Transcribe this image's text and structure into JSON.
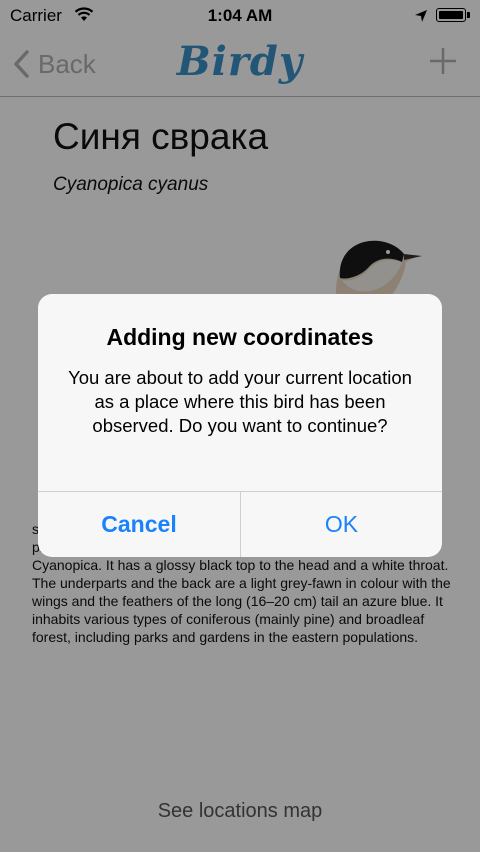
{
  "status_bar": {
    "carrier": "Carrier",
    "time": "1:04 AM"
  },
  "nav": {
    "back_label": "Back",
    "logo": "Birdy",
    "accent_color": "#3a8fc7"
  },
  "bird": {
    "name": "Синя сврака",
    "latin_name": "Cyanopica cyanus",
    "description": "shape to the Eurasian magpie (Pica pica) but is more slender with proportionately smaller legs and bill. It belongs to the genus Cyanopica. It has a glossy black top to the head and a white throat. The underparts and the back are a light grey-fawn in colour with the wings and the feathers of the long (16–20 cm) tail an azure blue. It inhabits various types of coniferous (mainly pine) and broadleaf forest, including parks and gardens in the eastern populations."
  },
  "footer": {
    "map_link": "See locations map"
  },
  "alert": {
    "title": "Adding new coordinates",
    "message": "You are about to add your current location as a place where this bird has been observed. Do you want to continue?",
    "cancel_label": "Cancel",
    "ok_label": "OK",
    "button_color": "#1a82fb"
  }
}
